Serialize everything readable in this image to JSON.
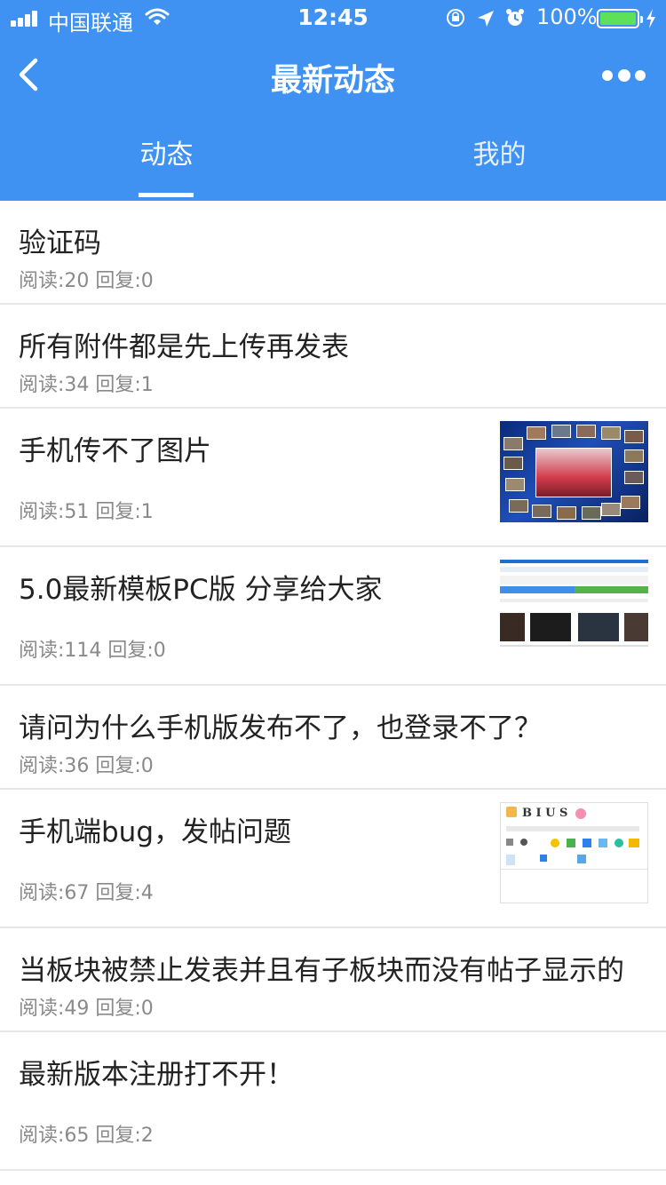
{
  "status_bar": {
    "carrier": "中国联通",
    "time": "12:45",
    "battery_percent": "100%"
  },
  "nav": {
    "title": "最新动态"
  },
  "tabs": [
    {
      "label": "动态",
      "active": true
    },
    {
      "label": "我的",
      "active": false
    }
  ],
  "posts": [
    {
      "title": "验证码",
      "meta": "阅读:20  回复:0"
    },
    {
      "title": "所有附件都是先上传再发表",
      "meta": "阅读:34  回复:1"
    },
    {
      "title": "手机传不了图片",
      "meta": "阅读:51  回复:1"
    },
    {
      "title": "5.0最新模板PC版 分享给大家",
      "meta": "阅读:114  回复:0"
    },
    {
      "title": "请问为什么手机版发布不了，也登录不了？",
      "meta": "阅读:36  回复:0"
    },
    {
      "title": "手机端bug，发帖问题",
      "meta": "阅读:67  回复:4"
    },
    {
      "title": "当板块被禁止发表并且有子板块而没有帖子显示的",
      "meta": "阅读:49  回复:0"
    },
    {
      "title": "最新版本注册打不开！",
      "meta": "阅读:65  回复:2"
    }
  ],
  "colors": {
    "header": "#3f92f1",
    "battery": "#5ee15a"
  },
  "icons": [
    "signal-icon",
    "wifi-icon",
    "lock-rotation-icon",
    "location-icon",
    "alarm-icon",
    "battery-icon",
    "charging-icon",
    "back-arrow-icon",
    "more-icon"
  ]
}
